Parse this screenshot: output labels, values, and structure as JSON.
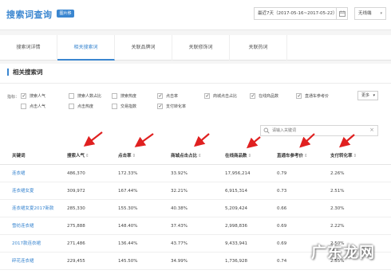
{
  "header": {
    "title": "搜索词查询",
    "badge": "图片移",
    "date_range": "最近7天（2017-05-16~2017-05-22）",
    "device": "无线端"
  },
  "tabs": [
    {
      "label": "搜索词详情"
    },
    {
      "label": "相关搜索词"
    },
    {
      "label": "关联品牌词"
    },
    {
      "label": "关联修饰词"
    },
    {
      "label": "关联热词"
    }
  ],
  "section": {
    "title": "相关搜索词",
    "metrics_label": "指标：",
    "more_label": "更多"
  },
  "metrics": [
    {
      "label": "搜索人气",
      "checked": true
    },
    {
      "label": "搜索人数占比",
      "checked": false
    },
    {
      "label": "搜索热度",
      "checked": false
    },
    {
      "label": "点击率",
      "checked": true
    },
    {
      "label": "商城点击占比",
      "checked": true
    },
    {
      "label": "在线商品数",
      "checked": true
    },
    {
      "label": "直通车参考价",
      "checked": true
    },
    {
      "label": "点击人气",
      "checked": false
    },
    {
      "label": "点击热度",
      "checked": false
    },
    {
      "label": "交易指数",
      "checked": false
    },
    {
      "label": "支付转化率",
      "checked": true
    }
  ],
  "search": {
    "placeholder": "请输入关键词"
  },
  "table": {
    "headers": [
      "关键词",
      "搜索人气",
      "点击率",
      "商城点击占比",
      "在线商品数",
      "直通车参考价",
      "支付转化率"
    ],
    "rows": [
      [
        "连衣裙",
        "486,370",
        "172.33%",
        "33.92%",
        "17,956,214",
        "0.79",
        "2.26%"
      ],
      [
        "连衣裙女夏",
        "309,972",
        "167.44%",
        "32.21%",
        "6,915,314",
        "0.73",
        "2.51%"
      ],
      [
        "连衣裙女夏2017新款",
        "285,330",
        "155.30%",
        "40.38%",
        "5,209,424",
        "0.66",
        "2.30%"
      ],
      [
        "雪纺连衣裙",
        "275,888",
        "148.40%",
        "37.43%",
        "2,998,836",
        "0.69",
        "2.22%"
      ],
      [
        "2017款连衣裙",
        "271,486",
        "136.44%",
        "43.77%",
        "9,433,941",
        "0.69",
        "2.50%"
      ],
      [
        "碎花连衣裙",
        "229,455",
        "145.50%",
        "34.99%",
        "1,736,928",
        "0.74",
        "2.55%"
      ]
    ]
  },
  "watermark": {
    "text": "广东龙网"
  },
  "colors": {
    "accent": "#3a86d0",
    "arrow": "#e02020"
  }
}
